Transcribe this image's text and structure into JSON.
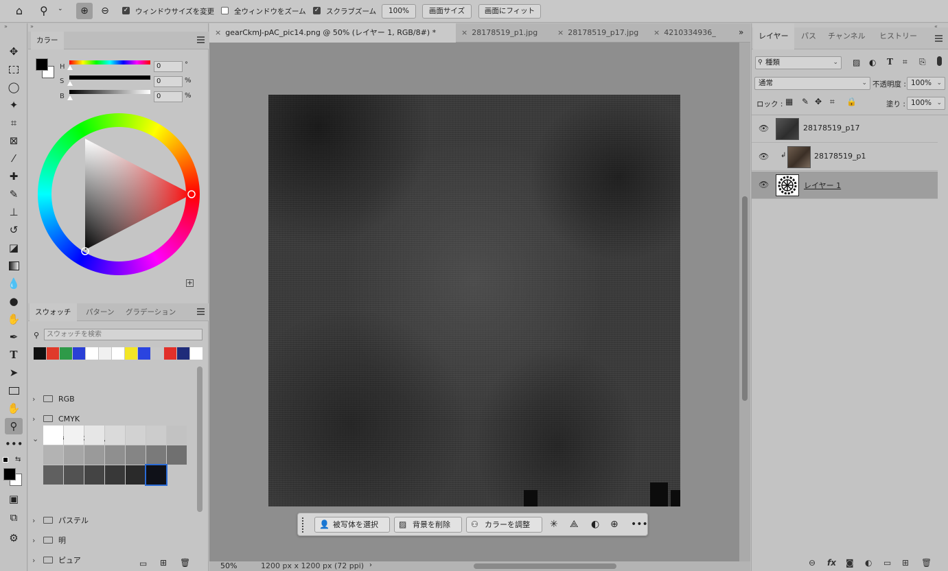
{
  "options_bar": {
    "resize_windows_label": "ウィンドウサイズを変更",
    "zoom_all_label": "全ウィンドウをズーム",
    "scrubby_zoom_label": "スクラブズーム",
    "zoom_100_label": "100%",
    "fit_screen_label": "画面サイズ",
    "fill_screen_label": "画面にフィット"
  },
  "color_panel": {
    "tab_label": "カラー",
    "h_label": "H",
    "s_label": "S",
    "b_label": "B",
    "h_value": "0",
    "s_value": "0",
    "b_value": "0",
    "h_unit": "°",
    "s_unit": "%",
    "b_unit": "%"
  },
  "swatches_panel": {
    "tabs": [
      "スウォッチ",
      "パターン",
      "グラデーション"
    ],
    "search_placeholder": "スウォッチを検索",
    "recent_colors": [
      "#111111",
      "#e03a2a",
      "#2e9a48",
      "#2a3fd6",
      "#ffffff",
      "#f0f0f0",
      "#ffffff",
      "#f3e626",
      "#2a44e0",
      "#c8c8c8",
      "#e2302a",
      "#1f2c7a",
      "#ffffff"
    ],
    "folders": [
      {
        "label": "RGB",
        "expanded": false
      },
      {
        "label": "CMYK",
        "expanded": false
      },
      {
        "label": "グレースケール",
        "expanded": true
      },
      {
        "label": "パステル",
        "expanded": false
      },
      {
        "label": "明",
        "expanded": false
      },
      {
        "label": "ピュア",
        "expanded": false
      }
    ],
    "grayscale_swatches": [
      "#ffffff",
      "#f2f2f2",
      "#e6e6e6",
      "#dadada",
      "#d2d2d2",
      "#cccccc",
      "#c2c2c2",
      "#b3b3b3",
      "#a6a6a6",
      "#9a9a9a",
      "#8f8f8f",
      "#858585",
      "#7a7a7a",
      "#707070",
      "#606060",
      "#525252",
      "#444444",
      "#383838",
      "#2a2a2a",
      "#0f1118"
    ]
  },
  "document_tabs": [
    {
      "label": "gearCkmJ-pAC_pic14.png @ 50% (レイヤー 1, RGB/8#) *",
      "active": true
    },
    {
      "label": "28178519_p1.jpg",
      "active": false
    },
    {
      "label": "28178519_p17.jpg",
      "active": false
    },
    {
      "label": "4210334936_",
      "active": false
    }
  ],
  "task_bar": {
    "select_subject_label": "被写体を選択",
    "remove_bg_label": "背景を削除",
    "adjust_color_label": "カラーを調整"
  },
  "status_bar": {
    "zoom_value": "50%",
    "doc_info": "1200 px x 1200 px (72 ppi)"
  },
  "layers_panel": {
    "tabs": [
      "レイヤー",
      "パス",
      "チャンネル",
      "ヒストリー"
    ],
    "filter_kind": "種類",
    "blend_mode": "通常",
    "opacity_label": "不透明度 :",
    "opacity_value": "100%",
    "lock_label": "ロック :",
    "fill_label": "塗り :",
    "fill_value": "100%",
    "layers": [
      {
        "name": "28178519_p17",
        "visible": true,
        "selected": false,
        "clipped": false
      },
      {
        "name": "28178519_p1",
        "visible": true,
        "selected": false,
        "clipped": true
      },
      {
        "name": "レイヤー 1",
        "visible": true,
        "selected": true,
        "clipped": false
      }
    ]
  },
  "icons": {
    "home": "home-icon",
    "zoom": "zoom-icon",
    "zoom_in": "zoom-in-icon",
    "zoom_out": "zoom-out-icon"
  },
  "colors": {
    "foreground": "#000000",
    "background": "#ffffff",
    "accent_selected": "#2a6bd6"
  }
}
